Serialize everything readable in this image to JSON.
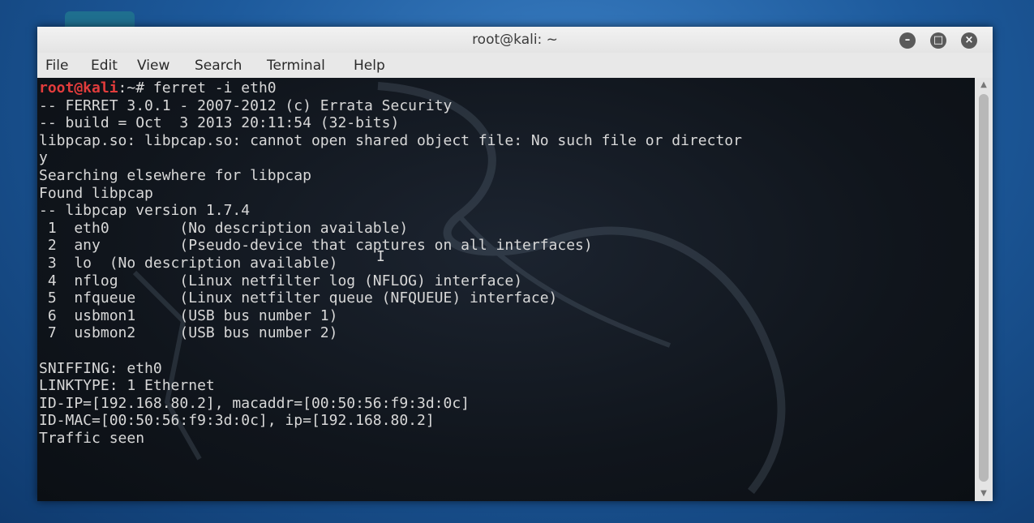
{
  "window": {
    "title": "root@kali: ~"
  },
  "window_buttons": [
    "minimize-icon",
    "maximize-icon",
    "close-icon"
  ],
  "menu": [
    "File",
    "Edit",
    "View",
    "Search",
    "Terminal",
    "Help"
  ],
  "prompt": {
    "user_host": "root@kali",
    "path": ":~# ",
    "command": "ferret -i eth0"
  },
  "output": [
    "-- FERRET 3.0.1 - 2007-2012 (c) Errata Security",
    "-- build = Oct  3 2013 20:11:54 (32-bits)",
    "libpcap.so: libpcap.so: cannot open shared object file: No such file or director",
    "y",
    "Searching elsewhere for libpcap",
    "Found libpcap",
    "-- libpcap version 1.7.4",
    " 1  eth0        (No description available)",
    " 2  any         (Pseudo-device that captures on all interfaces)",
    " 3  lo  (No description available)",
    " 4  nflog       (Linux netfilter log (NFLOG) interface)",
    " 5  nfqueue     (Linux netfilter queue (NFQUEUE) interface)",
    " 6  usbmon1     (USB bus number 1)",
    " 7  usbmon2     (USB bus number 2)",
    "",
    "SNIFFING: eth0",
    "LINKTYPE: 1 Ethernet",
    "ID-IP=[192.168.80.2], macaddr=[00:50:56:f9:3d:0c]",
    "ID-MAC=[00:50:56:f9:3d:0c], ip=[192.168.80.2]",
    "Traffic seen"
  ],
  "colors": {
    "prompt_user": "#e23c3c",
    "terminal_text": "#d8d8d8",
    "terminal_bg": "#10151c"
  }
}
